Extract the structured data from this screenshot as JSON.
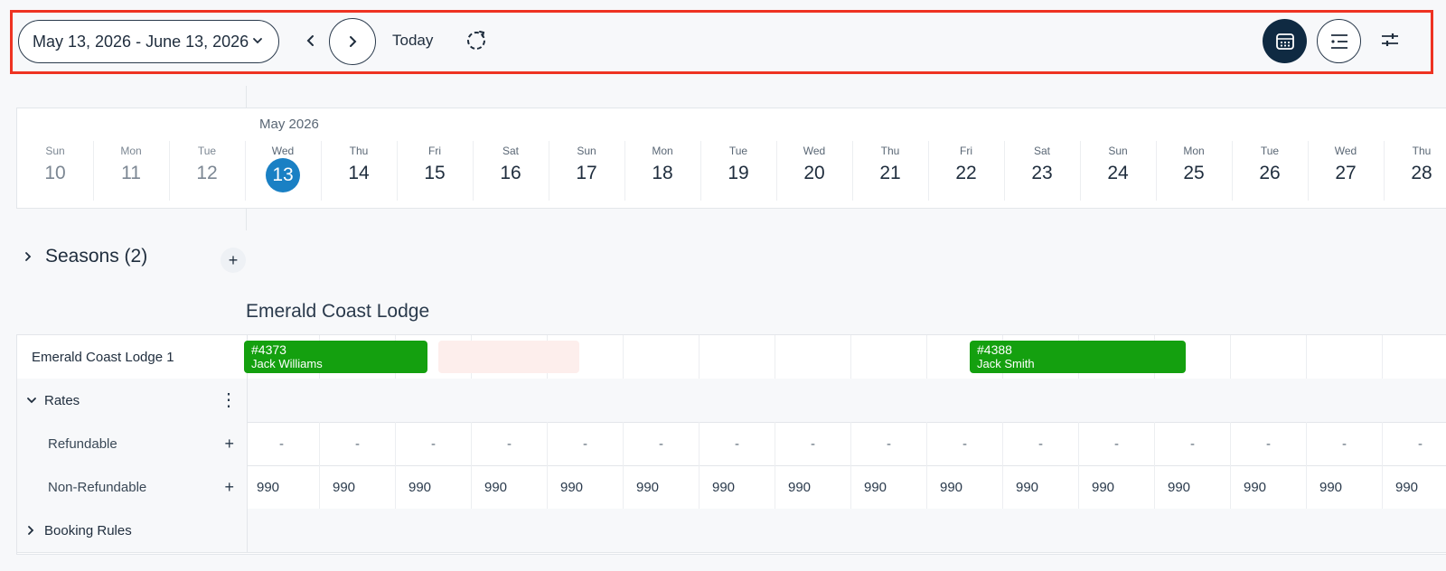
{
  "toolbar": {
    "date_range": "May 13, 2026 - June 13, 2026",
    "today_label": "Today",
    "accent_color": "#0f2a42",
    "highlight_border_color": "#ee3322"
  },
  "calendar": {
    "month_label": "May 2026",
    "today_color": "#1a80c4",
    "days": [
      {
        "dow": "Sun",
        "num": "10"
      },
      {
        "dow": "Mon",
        "num": "11"
      },
      {
        "dow": "Tue",
        "num": "12"
      },
      {
        "dow": "Wed",
        "num": "13"
      },
      {
        "dow": "Thu",
        "num": "14"
      },
      {
        "dow": "Fri",
        "num": "15"
      },
      {
        "dow": "Sat",
        "num": "16"
      },
      {
        "dow": "Sun",
        "num": "17"
      },
      {
        "dow": "Mon",
        "num": "18"
      },
      {
        "dow": "Tue",
        "num": "19"
      },
      {
        "dow": "Wed",
        "num": "20"
      },
      {
        "dow": "Thu",
        "num": "21"
      },
      {
        "dow": "Fri",
        "num": "22"
      },
      {
        "dow": "Sat",
        "num": "23"
      },
      {
        "dow": "Sun",
        "num": "24"
      },
      {
        "dow": "Mon",
        "num": "25"
      },
      {
        "dow": "Tue",
        "num": "26"
      },
      {
        "dow": "Wed",
        "num": "27"
      },
      {
        "dow": "Thu",
        "num": "28"
      }
    ]
  },
  "seasons": {
    "label": "Seasons (2)",
    "add_label": "+"
  },
  "property": {
    "title": "Emerald Coast Lodge",
    "unit_name": "Emerald Coast Lodge 1",
    "bookings": [
      {
        "id": "#4373",
        "guest": "Jack Williams",
        "color": "#14a00f"
      },
      {
        "id": "#4388",
        "guest": "Jack Smith",
        "color": "#14a00f"
      }
    ],
    "blocked_color": "#fdeeec"
  },
  "rates": {
    "label": "Rates",
    "kebab": "⋮",
    "plans": [
      {
        "name": "Refundable",
        "add": "+",
        "values": [
          "-",
          "-",
          "-",
          "-",
          "-",
          "-",
          "-",
          "-",
          "-",
          "-",
          "-",
          "-",
          "-",
          "-",
          "-",
          "-"
        ]
      },
      {
        "name": "Non-Refundable",
        "add": "+",
        "values": [
          "990",
          "990",
          "990",
          "990",
          "990",
          "990",
          "990",
          "990",
          "990",
          "990",
          "990",
          "990",
          "990",
          "990",
          "990",
          "990"
        ]
      }
    ]
  },
  "booking_rules": {
    "label": "Booking Rules"
  }
}
